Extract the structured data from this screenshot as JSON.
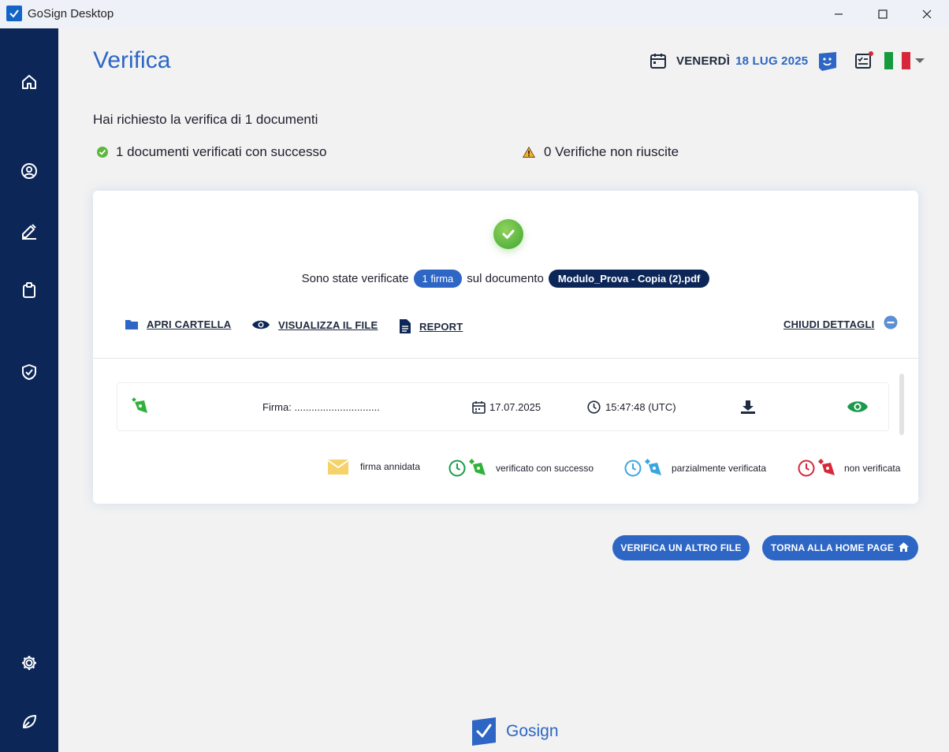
{
  "window": {
    "title": "GoSign Desktop"
  },
  "sidebar": {
    "items": [
      {
        "icon": "home-icon"
      },
      {
        "icon": "user-icon"
      },
      {
        "icon": "signature-icon"
      },
      {
        "icon": "clipboard-icon"
      },
      {
        "icon": "shield-check-icon"
      },
      {
        "icon": "gear-icon"
      },
      {
        "icon": "leaf-icon"
      }
    ]
  },
  "header": {
    "title": "Verifica",
    "day": "VENERDÌ",
    "date": "18 LUG 2025"
  },
  "summary": {
    "requested": "Hai richiesto la verifica di 1 documenti",
    "success": "1 documenti verificati con successo",
    "failed": "0 Verifiche non riuscite"
  },
  "card": {
    "verified_prefix": "Sono state verificate",
    "signatures_pill": "1 firma",
    "verified_middle": "sul documento",
    "document_pill": "Modulo_Prova - Copia (2).pdf",
    "actions": {
      "open_folder": "APRI CARTELLA",
      "view_file": "VISUALIZZA IL FILE",
      "report": "REPORT",
      "close_details": "CHIUDI DETTAGLI"
    },
    "signature": {
      "label": "Firma: ..............................",
      "date": "17.07.2025",
      "time": "15:47:48 (UTC)"
    },
    "legend": {
      "nested": "firma annidata",
      "verified": "verificato con successo",
      "partial": "parzialmente verificata",
      "not_verified": "non verificata"
    }
  },
  "buttons": {
    "verify_another": "VERIFICA UN ALTRO FILE",
    "home_page": "TORNA ALLA HOME PAGE"
  },
  "footer": {
    "brand": "Gosign"
  },
  "colors": {
    "sidebar": "#0c2658",
    "accent": "#2d66c4",
    "success": "#3fa632",
    "partial": "#3aa6e0",
    "error": "#d62839",
    "nested": "#f5d36a"
  }
}
